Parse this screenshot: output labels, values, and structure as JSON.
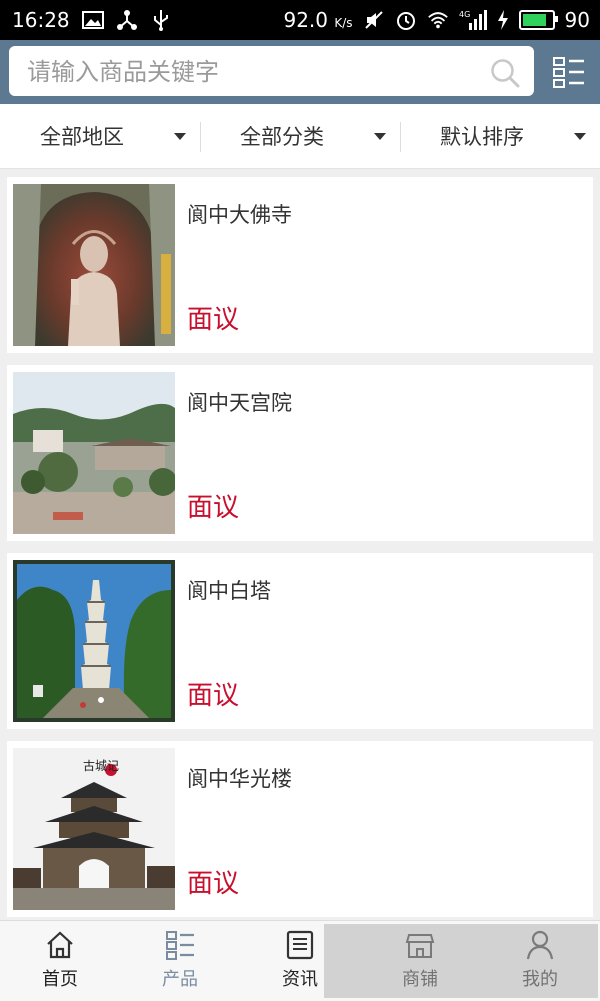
{
  "status_bar": {
    "time": "16:28",
    "speed": "92.0",
    "speed_unit": "K/s",
    "network": "4G",
    "battery": "90",
    "battery_level": 0.9,
    "icons": [
      "image-icon",
      "share-icon",
      "usb-icon",
      "mute-icon",
      "alarm-icon",
      "wifi-icon",
      "signal-icon",
      "charging-icon",
      "battery-icon"
    ]
  },
  "search": {
    "placeholder": "请输入商品关键字",
    "value": ""
  },
  "filters": [
    {
      "label": "全部地区"
    },
    {
      "label": "全部分类"
    },
    {
      "label": "默认排序"
    }
  ],
  "products": [
    {
      "title": "阆中大佛寺",
      "price": "面议"
    },
    {
      "title": "阆中天宫院",
      "price": "面议"
    },
    {
      "title": "阆中白塔",
      "price": "面议"
    },
    {
      "title": "阆中华光楼",
      "price": "面议"
    }
  ],
  "thumb_text": {
    "ancient_city_seal": "古城记"
  },
  "nav": [
    {
      "label": "首页"
    },
    {
      "label": "产品"
    },
    {
      "label": "资讯"
    },
    {
      "label": "商铺"
    },
    {
      "label": "我的"
    }
  ],
  "colors": {
    "header": "#5d7891",
    "price": "#c8102e",
    "nav_active": "#7a8ca0",
    "battery": "#2fd35b"
  }
}
